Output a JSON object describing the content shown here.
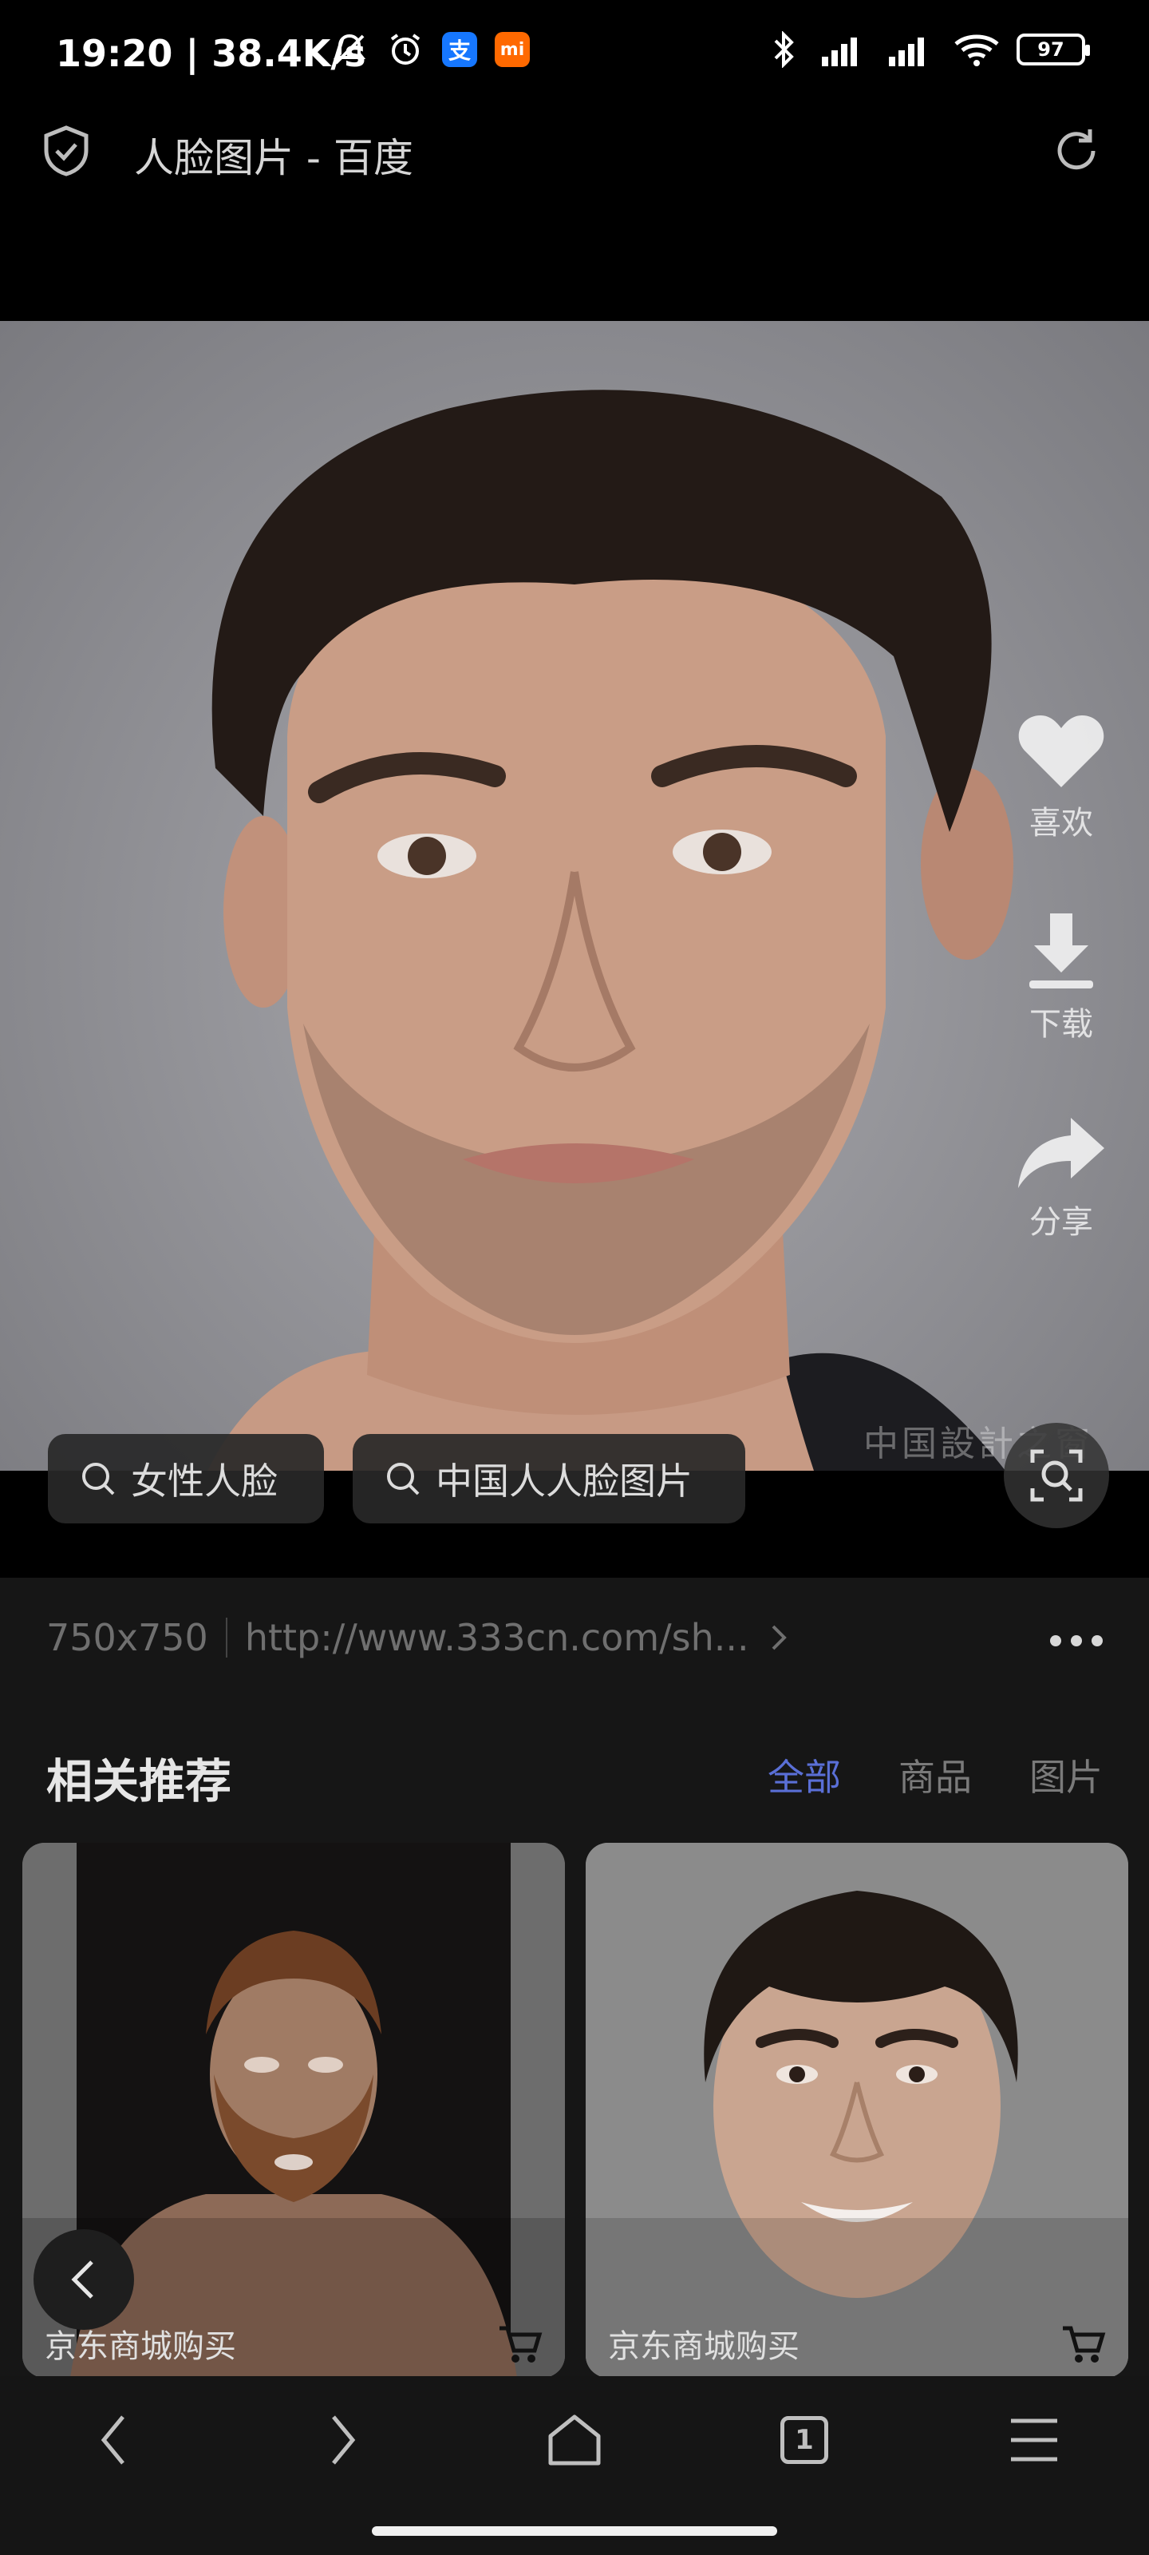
{
  "status_bar": {
    "time": "19:20 | 38.4K/s",
    "alipay_badge": "支",
    "mi_badge": "mi",
    "battery": "97"
  },
  "header": {
    "title": "人脸图片 - 百度"
  },
  "image": {
    "watermark": "中国設計之窗"
  },
  "side_actions": {
    "like": "喜欢",
    "download": "下载",
    "share": "分享"
  },
  "search_chips": [
    "女性人脸",
    "中国人人脸图片"
  ],
  "info": {
    "size": "750x750",
    "url": "http://www.333cn.com/sh..."
  },
  "related": {
    "title": "相关推荐",
    "tabs": [
      "全部",
      "商品",
      "图片"
    ]
  },
  "cards": [
    {
      "caption": "京东商城购买"
    },
    {
      "caption": "京东商城购买"
    }
  ],
  "nav": {
    "tab_count": "1"
  },
  "colors": {
    "accent": "#5a6fd6",
    "alipay": "#1677ff",
    "mi": "#ff6900"
  }
}
